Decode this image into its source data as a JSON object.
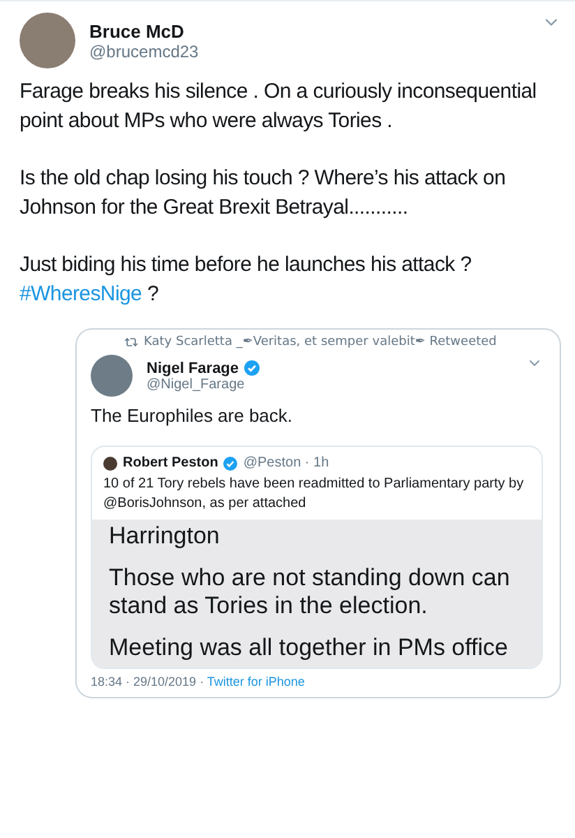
{
  "tweet": {
    "name": "Bruce McD",
    "handle": "@brucemcd23",
    "paragraphs": [
      {
        "text": "Farage breaks his silence . On a curiously inconsequential point about  MPs who were always Tories ."
      },
      {
        "text": "Is the old chap losing his touch ? Where’s his attack on Johnson for the Great Brexit Betrayal..........."
      },
      {
        "text": "Just biding his time before he launches his attack ?",
        "hashtag": "#WheresNige",
        "after": " ?"
      }
    ]
  },
  "retweet": {
    "retweeted_by": "Katy Scarletta _✒Veritas, et semper valebit✒ Retweeted",
    "name": "Nigel Farage",
    "verified": true,
    "handle": "@Nigel_Farage",
    "text": "The Europhiles are back.",
    "quote": {
      "name": "Robert Peston",
      "verified": true,
      "handle": "@Peston · 1h",
      "text": "10 of 21 Tory rebels have been readmitted to Parliamentary party by @BorisJohnson, as per attached",
      "image_lines": [
        "Harrington",
        "Those who are not standing down can stand as Tories in the election.",
        "Meeting was all together in PMs office"
      ]
    },
    "timestamp": "18:34 · 29/10/2019 · ",
    "source": "Twitter for iPhone"
  }
}
